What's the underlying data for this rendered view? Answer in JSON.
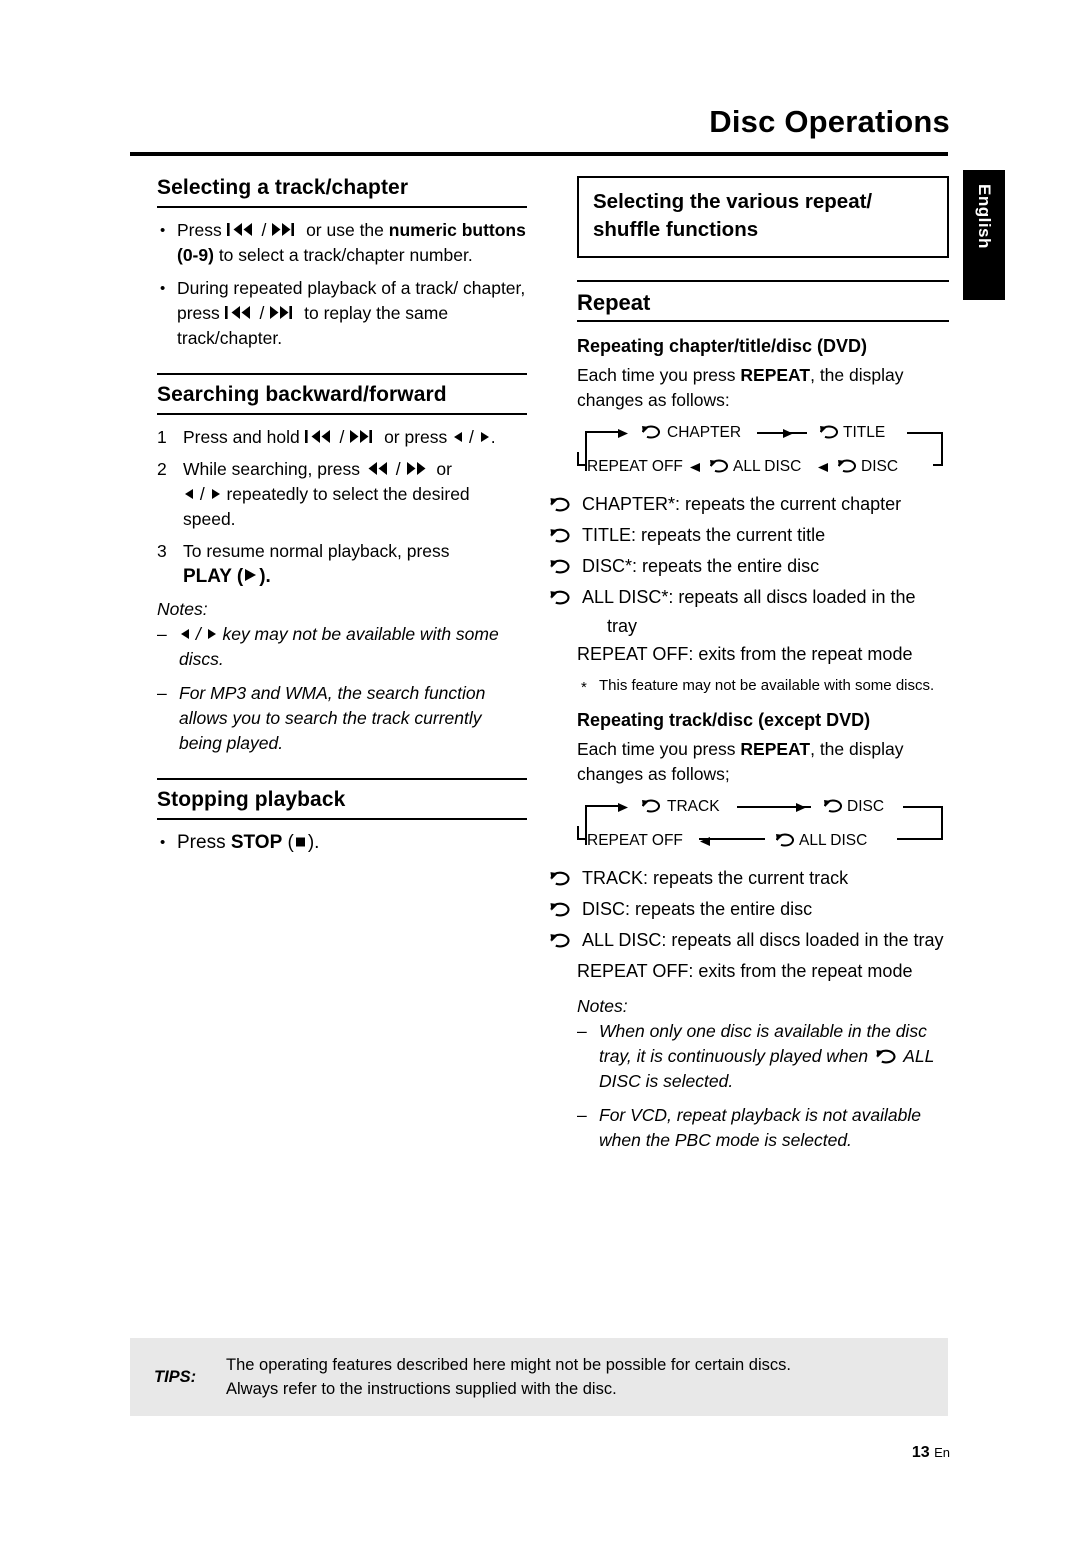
{
  "header": {
    "title": "Disc Operations",
    "side_tab": "English"
  },
  "left": {
    "sec1": {
      "heading": "Selecting a track/chapter",
      "bullets": [
        {
          "pre": "Press ",
          "icons": "prev / next",
          "mid": " or use the ",
          "bold1": "numeric buttons (0-9)",
          "post": " to select a track/chapter number."
        },
        {
          "pre": "During repeated playback of a track/ chapter, press ",
          "icons": "prev / next",
          "post": " to replay the same track/chapter."
        }
      ]
    },
    "sec2": {
      "heading": "Searching backward/forward",
      "steps": [
        {
          "n": "1",
          "text_a": "Press and hold ",
          "icons": "prev / next",
          "text_b": " or press ",
          "icons2": "left / right",
          "text_c": "."
        },
        {
          "n": "2",
          "text_a": "While searching, press ",
          "icons": "rew / ff",
          "text_b": " or ",
          "icons2": "left / right",
          "text_c": " repeatedly to select the desired speed."
        },
        {
          "n": "3",
          "text_a": "To resume normal playback, press ",
          "bold": "PLAY",
          "text_b": " (",
          "icon": "play-triangle",
          "text_c": ")."
        }
      ],
      "notes_label": "Notes:",
      "notes": [
        {
          "pre": "",
          "icons": "left / right",
          "post": " key may not be available with some discs."
        },
        {
          "pre": "For MP3 and WMA, the search function allows you to search the track currently being played.",
          "icons": "",
          "post": ""
        }
      ]
    },
    "sec3": {
      "heading": "Stopping playback",
      "bullet_pre": "Press ",
      "bullet_bold": "STOP",
      "bullet_mid": " (",
      "bullet_icon": "stop-square",
      "bullet_post": ")."
    }
  },
  "right": {
    "boxed_heading": "Selecting the various repeat/ shuffle functions",
    "repeat_heading": "Repeat",
    "dvd": {
      "sub_heading": "Repeating chapter/title/disc (DVD)",
      "intro_a": "Each time you press ",
      "intro_bold": "REPEAT",
      "intro_b": ", the display changes as follows:",
      "diagram_top": [
        "CHAPTER",
        "TITLE"
      ],
      "diagram_bottom": [
        "REPEAT OFF",
        "ALL DISC",
        "DISC"
      ],
      "items": [
        {
          "cycle": true,
          "label": "CHAPTER*",
          "desc": ": repeats the current chapter"
        },
        {
          "cycle": true,
          "label": "TITLE",
          "desc": ": repeats the current title"
        },
        {
          "cycle": true,
          "label": "DISC*",
          "desc": ": repeats the entire disc"
        },
        {
          "cycle": true,
          "label": "ALL DISC*",
          "desc": ": repeats all discs loaded in the tray"
        },
        {
          "cycle": false,
          "label": "REPEAT OFF",
          "desc": ": exits from the repeat mode"
        }
      ],
      "footnote": "This feature may not be available with some discs."
    },
    "nondvd": {
      "sub_heading": "Repeating track/disc (except DVD)",
      "intro_a": "Each time you press ",
      "intro_bold": "REPEAT",
      "intro_b": ", the display changes as follows;",
      "diagram_top": [
        "TRACK",
        "DISC"
      ],
      "diagram_bottom": [
        "REPEAT OFF",
        "ALL DISC"
      ],
      "items": [
        {
          "cycle": true,
          "label": "TRACK",
          "desc": ": repeats the current track"
        },
        {
          "cycle": true,
          "label": "DISC",
          "desc": ": repeats the entire disc"
        },
        {
          "cycle": true,
          "label": "ALL DISC",
          "desc": ": repeats all discs loaded in the tray"
        },
        {
          "cycle": false,
          "label": "REPEAT OFF",
          "desc": ": exits from the repeat mode"
        }
      ]
    },
    "notes_label": "Notes:",
    "notes": [
      {
        "a": "When only one disc is available in the disc tray, it is continuously played when ",
        "icon": "cycle",
        "b": " ALL DISC is selected."
      },
      {
        "a": "For VCD, repeat playback is not available when the PBC mode is selected.",
        "icon": "",
        "b": ""
      }
    ]
  },
  "tips": {
    "label": "TIPS:",
    "line1": "The operating features described here might not be possible for certain discs.",
    "line2": "Always refer to the instructions supplied with the disc."
  },
  "footer": {
    "page": "13",
    "lang": "En"
  }
}
